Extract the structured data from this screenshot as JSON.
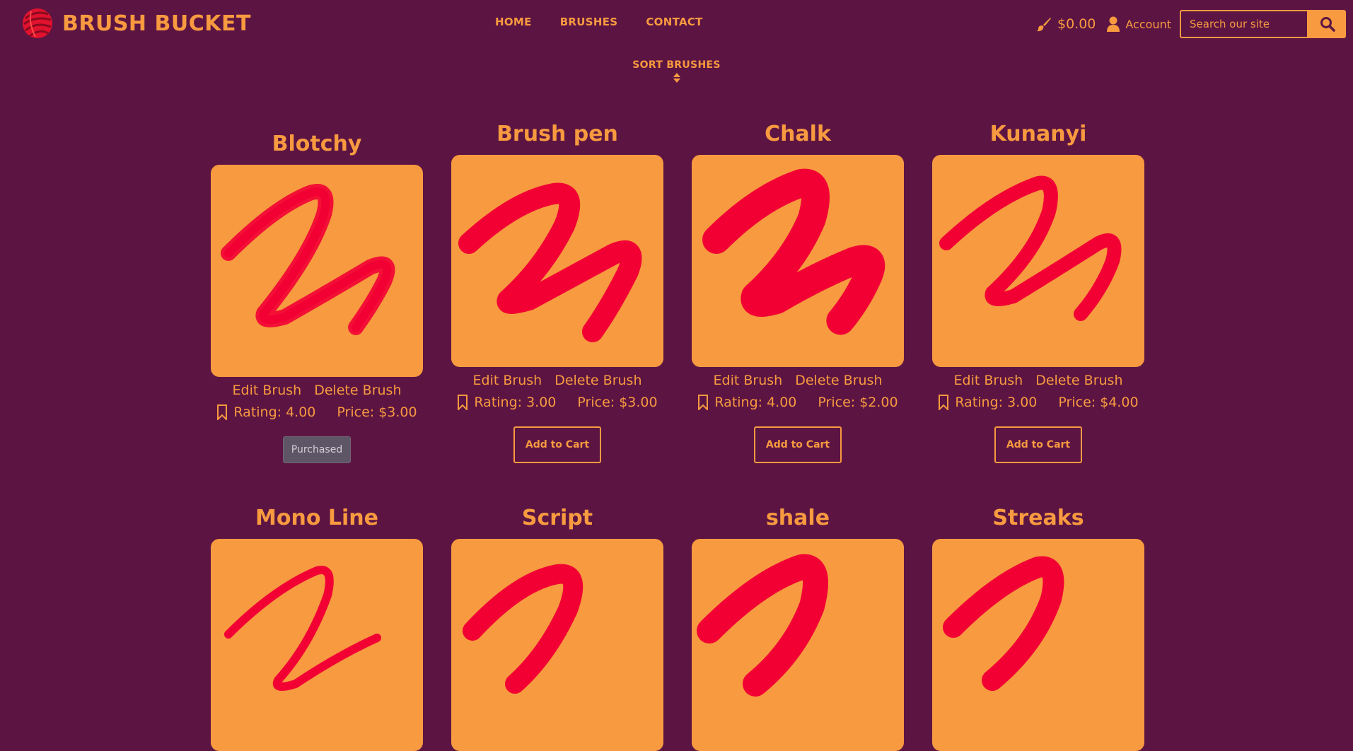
{
  "brand": {
    "name": "BRUSH BUCKET",
    "logo_icon": "brush-ball-logo-icon"
  },
  "nav": {
    "home": "HOME",
    "brushes": "BRUSHES",
    "contact": "CONTACT"
  },
  "cart": {
    "icon": "paintbrush-icon",
    "total": "$0.00"
  },
  "account": {
    "icon": "user-icon",
    "label": "Account"
  },
  "search": {
    "placeholder": "Search our site",
    "icon": "search-icon"
  },
  "sort": {
    "label": "SORT BRUSHES",
    "icon": "sort-icon"
  },
  "colors": {
    "background": "#5c1542",
    "accent": "#f79a40",
    "stroke": "#f20034"
  },
  "labels": {
    "edit": "Edit Brush",
    "delete": "Delete Brush",
    "add_to_cart": "Add to Cart",
    "purchased": "Purchased"
  },
  "brushes": [
    {
      "name": "Blotchy",
      "rating": "Rating: 4.00",
      "price": "Price: $3.00",
      "purchased": true
    },
    {
      "name": "Brush pen",
      "rating": "Rating: 3.00",
      "price": "Price: $3.00",
      "purchased": false
    },
    {
      "name": "Chalk",
      "rating": "Rating: 4.00",
      "price": "Price: $2.00",
      "purchased": false
    },
    {
      "name": "Kunanyi",
      "rating": "Rating: 3.00",
      "price": "Price: $4.00",
      "purchased": false
    },
    {
      "name": "Mono Line"
    },
    {
      "name": "Script"
    },
    {
      "name": "shale"
    },
    {
      "name": "Streaks"
    }
  ]
}
